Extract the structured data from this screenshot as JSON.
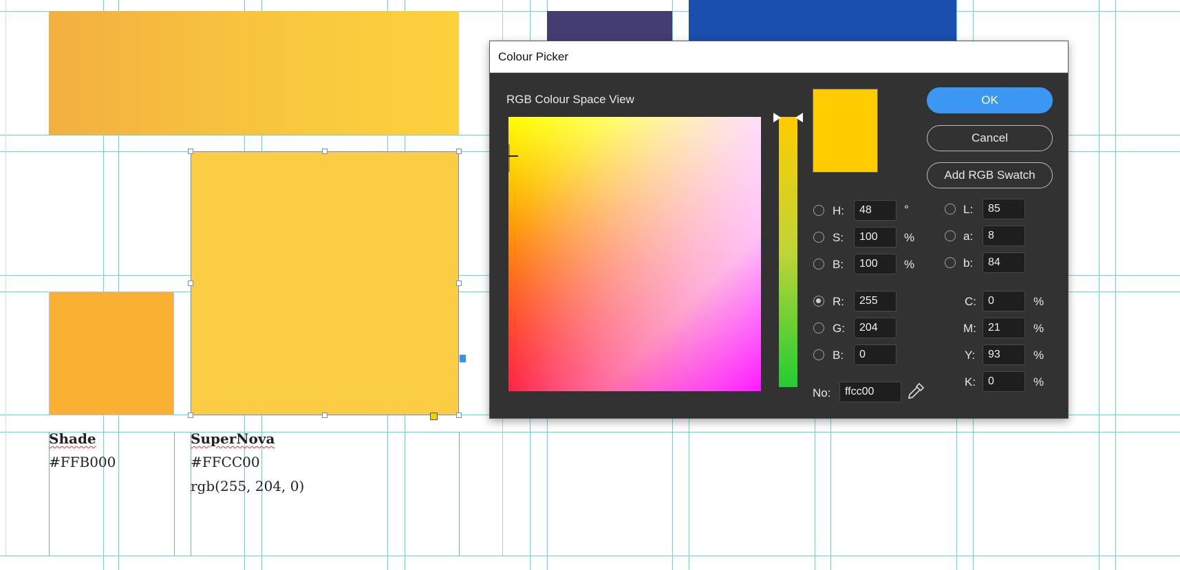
{
  "document": {
    "swatches": [
      {
        "name": "Shade",
        "hex": "#FFB000"
      },
      {
        "name": "SuperNova",
        "hex": "#FFCC00",
        "rgb": "rgb(255, 204, 0)"
      }
    ]
  },
  "dialog": {
    "title": "Colour Picker",
    "view_label": "RGB Colour Space View",
    "current_color": "#ffcc00",
    "buttons": {
      "ok": "OK",
      "cancel": "Cancel",
      "add_swatch": "Add RGB Swatch"
    },
    "hsb": [
      {
        "label": "H:",
        "value": "48",
        "unit": "°"
      },
      {
        "label": "S:",
        "value": "100",
        "unit": "%"
      },
      {
        "label": "B:",
        "value": "100",
        "unit": "%"
      }
    ],
    "rgb": [
      {
        "label": "R:",
        "value": "255"
      },
      {
        "label": "G:",
        "value": "204"
      },
      {
        "label": "B:",
        "value": "0"
      }
    ],
    "lab": [
      {
        "label": "L:",
        "value": "85"
      },
      {
        "label": "a:",
        "value": "8"
      },
      {
        "label": "b:",
        "value": "84"
      }
    ],
    "cmyk": [
      {
        "label": "C:",
        "value": "0",
        "unit": "%"
      },
      {
        "label": "M:",
        "value": "21",
        "unit": "%"
      },
      {
        "label": "Y:",
        "value": "93",
        "unit": "%"
      },
      {
        "label": "K:",
        "value": "0",
        "unit": "%"
      }
    ],
    "hex_label": "No:",
    "hex_value": "ffcc00",
    "selected_channel": "R",
    "icons": {
      "eyedropper": "eyedropper-icon"
    }
  }
}
